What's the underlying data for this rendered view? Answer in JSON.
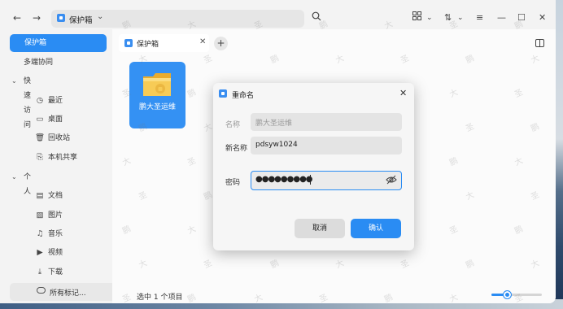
{
  "window": {
    "address": {
      "label": "保护箱",
      "icon": "vault-icon"
    },
    "toolbar": {
      "back": "←",
      "forward": "→",
      "search": "⌕",
      "view_mode": "▦",
      "sort": "⇅",
      "menu": "≡",
      "minimize": "—",
      "maximize": "☐",
      "close": "✕"
    }
  },
  "sidebar": {
    "active_item": "保护箱",
    "multi_screen": "多端协同",
    "quick_access": {
      "label": "快速访问",
      "items": [
        {
          "label": "最近",
          "icon": "clock-icon"
        },
        {
          "label": "桌面",
          "icon": "desktop-icon"
        },
        {
          "label": "回收站",
          "icon": "trash-icon"
        },
        {
          "label": "本机共享",
          "icon": "share-icon"
        }
      ]
    },
    "personal": {
      "label": "个人",
      "items": [
        {
          "label": "文档",
          "icon": "document-icon"
        },
        {
          "label": "图片",
          "icon": "picture-icon"
        },
        {
          "label": "音乐",
          "icon": "music-icon"
        },
        {
          "label": "视频",
          "icon": "video-icon"
        },
        {
          "label": "下载",
          "icon": "download-icon"
        }
      ]
    },
    "tags_button": "所有标记..."
  },
  "main": {
    "tab_label": "保护箱",
    "file": {
      "name": "鹏大圣运维"
    },
    "status": "选中 1 个项目",
    "zoom_level": 0.3
  },
  "dialog": {
    "title": "重命名",
    "name_label": "名称",
    "name_value": "鹏大圣运维",
    "new_name_label": "新名称",
    "new_name_value": "pdsyw1024",
    "password_label": "密码",
    "password_masked": "●●●●●●●●●",
    "cancel_label": "取消",
    "ok_label": "确认"
  },
  "watermark": {
    "text": "鹏 大 圣"
  },
  "colors": {
    "accent": "#2a8cf3",
    "folder": "#f5c44a"
  }
}
